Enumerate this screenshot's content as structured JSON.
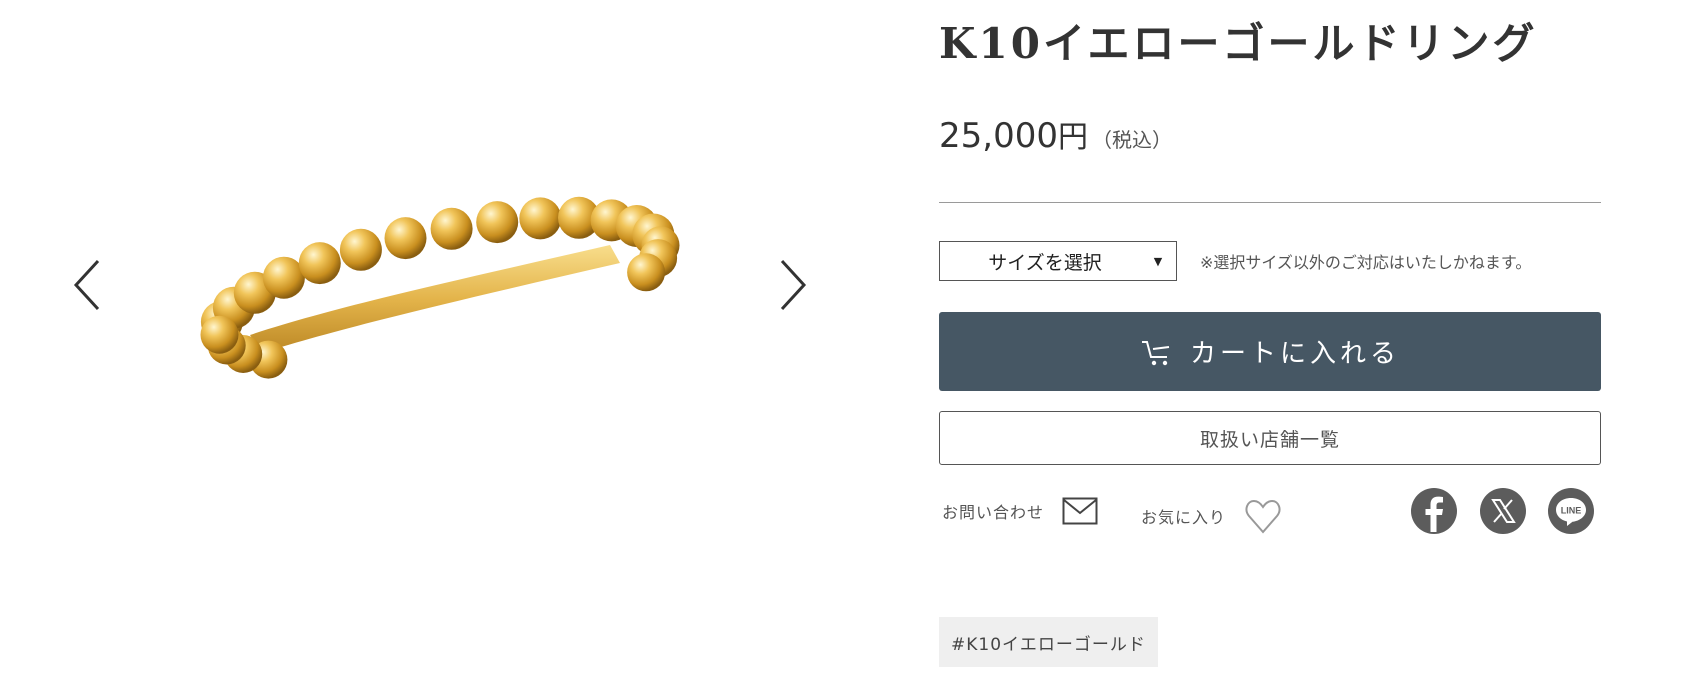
{
  "product": {
    "title": "K10イエローゴールドリング",
    "price_amount": "25,000",
    "price_unit": "円",
    "price_tax": "（税込）"
  },
  "size": {
    "select_label": "サイズを選択",
    "note": "※選択サイズ以外のご対応はいたしかねます。"
  },
  "buttons": {
    "cart_label": "カートに入れる",
    "stores_label": "取扱い店舗一覧"
  },
  "actions": {
    "contact_label": "お問い合わせ",
    "favorite_label": "お気に入り"
  },
  "share": {
    "icons": [
      "facebook-icon",
      "x-icon",
      "line-icon"
    ],
    "line_text": "LINE"
  },
  "tags": [
    "#K10イエローゴールド"
  ],
  "icons": {
    "gallery_prev": "chevron-left-icon",
    "gallery_next": "chevron-right-icon",
    "cart": "cart-icon",
    "contact": "mail-icon",
    "favorite": "heart-icon"
  },
  "colors": {
    "cart_button_bg": "#465764",
    "share_icon_bg": "#5c5c5c",
    "tag_bg": "#efefef",
    "ring_gold": "#d9a93a"
  }
}
